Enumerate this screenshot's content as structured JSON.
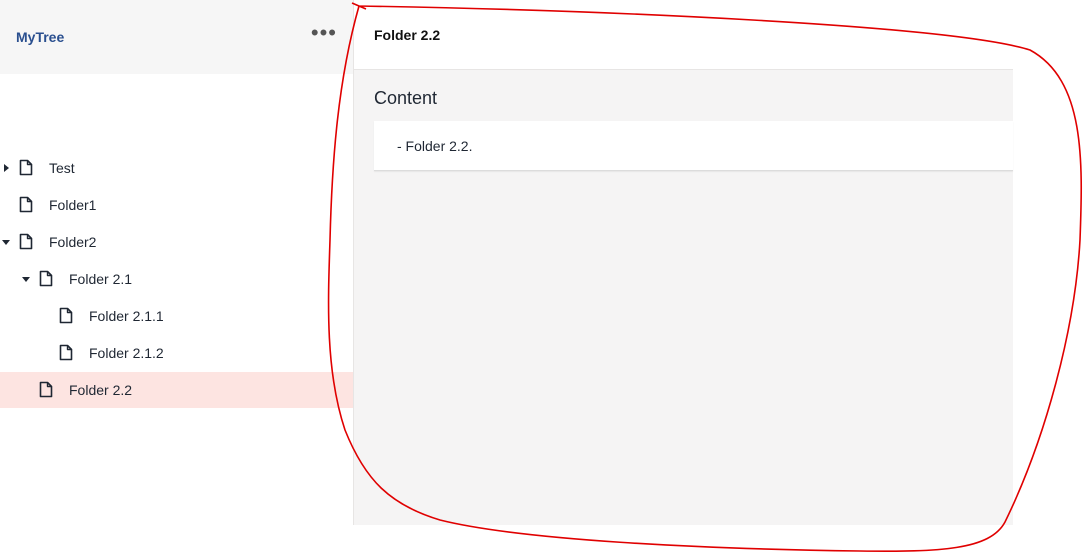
{
  "sidebar": {
    "brand": "MyTree",
    "menu_label": "•••",
    "tree": [
      {
        "label": "Test",
        "caret": "right",
        "level": 0,
        "selected": false
      },
      {
        "label": "Folder1",
        "caret": "none",
        "level": 0,
        "selected": false
      },
      {
        "label": "Folder2",
        "caret": "down",
        "level": 0,
        "selected": false
      },
      {
        "label": "Folder 2.1",
        "caret": "down",
        "level": 1,
        "selected": false
      },
      {
        "label": "Folder 2.1.1",
        "caret": "none",
        "level": 2,
        "selected": false
      },
      {
        "label": "Folder 2.1.2",
        "caret": "none",
        "level": 2,
        "selected": false
      },
      {
        "label": "Folder 2.2",
        "caret": "none",
        "level": 1,
        "selected": true
      }
    ]
  },
  "main": {
    "title": "Folder 2.2",
    "section_title": "Content",
    "content_text": "- Folder 2.2."
  },
  "colors": {
    "brand": "#2a4f8f",
    "selected_bg": "#fde4e1",
    "annotation": "#e00000"
  }
}
